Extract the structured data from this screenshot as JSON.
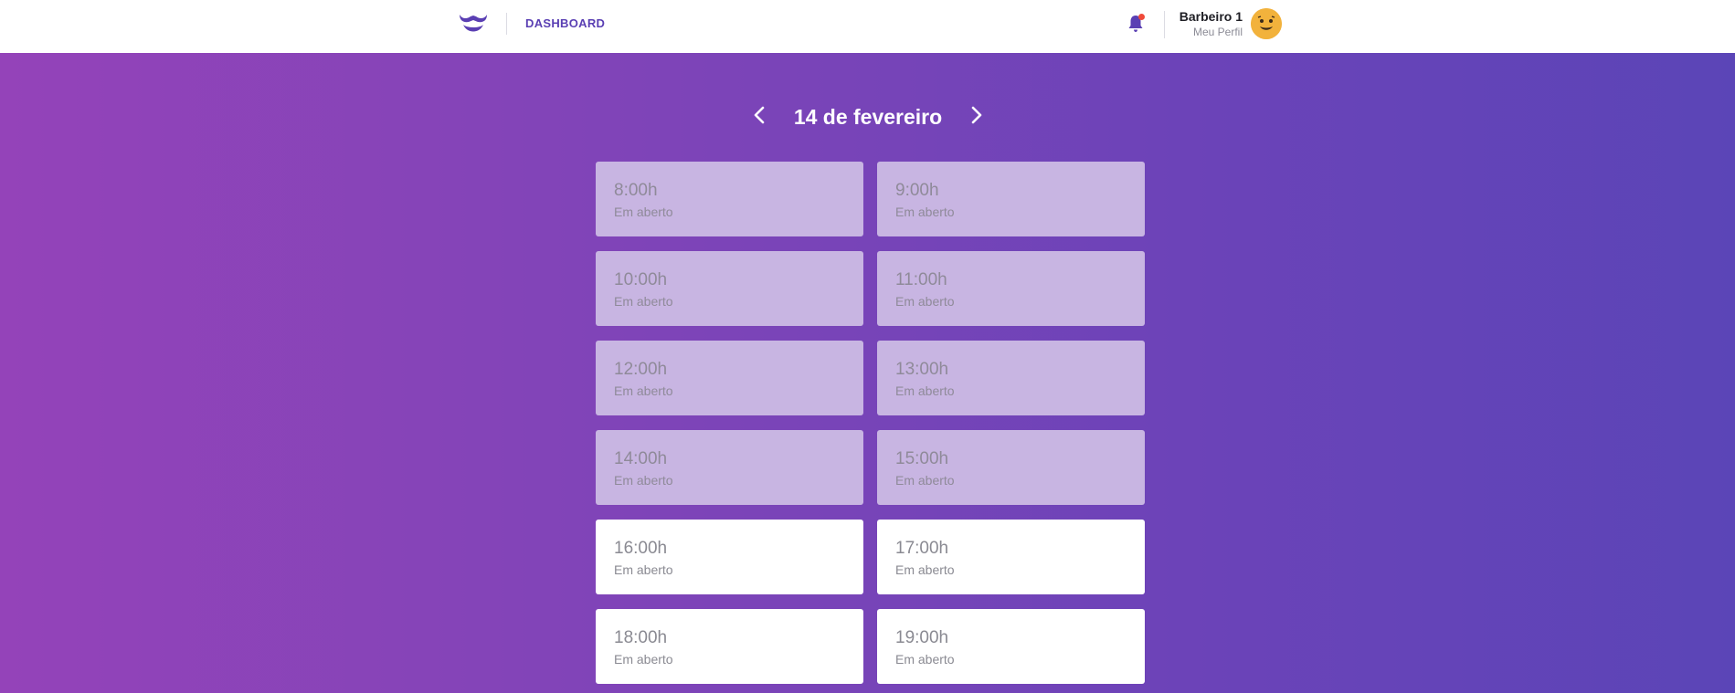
{
  "header": {
    "nav_dashboard": "DASHBOARD",
    "user_name": "Barbeiro 1",
    "profile_link": "Meu Perfil",
    "notification_dot_color": "#f04a3a"
  },
  "date_nav": {
    "title": "14 de fevereiro"
  },
  "slots": [
    {
      "time": "8:00h",
      "status": "Em aberto",
      "state": "past"
    },
    {
      "time": "9:00h",
      "status": "Em aberto",
      "state": "past"
    },
    {
      "time": "10:00h",
      "status": "Em aberto",
      "state": "past"
    },
    {
      "time": "11:00h",
      "status": "Em aberto",
      "state": "past"
    },
    {
      "time": "12:00h",
      "status": "Em aberto",
      "state": "past"
    },
    {
      "time": "13:00h",
      "status": "Em aberto",
      "state": "past"
    },
    {
      "time": "14:00h",
      "status": "Em aberto",
      "state": "past"
    },
    {
      "time": "15:00h",
      "status": "Em aberto",
      "state": "past"
    },
    {
      "time": "16:00h",
      "status": "Em aberto",
      "state": "open"
    },
    {
      "time": "17:00h",
      "status": "Em aberto",
      "state": "open"
    },
    {
      "time": "18:00h",
      "status": "Em aberto",
      "state": "open"
    },
    {
      "time": "19:00h",
      "status": "Em aberto",
      "state": "open"
    }
  ],
  "theme": {
    "accent": "#5a3fb3",
    "past_slot_bg": "#c8b5e2",
    "open_slot_bg": "#ffffff"
  }
}
